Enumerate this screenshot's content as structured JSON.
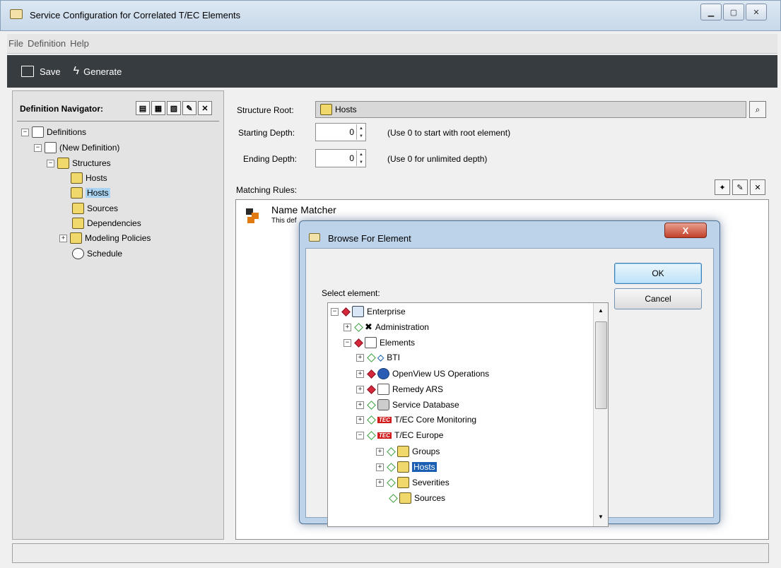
{
  "window": {
    "title": "Service Configuration for Correlated T/EC Elements"
  },
  "menu": [
    "File",
    "Definition",
    "Help"
  ],
  "toolbar": {
    "save": "Save",
    "generate": "Generate"
  },
  "navigator": {
    "title": "Definition Navigator:",
    "tree": [
      "Definitions",
      "(New Definition)",
      "Structures",
      "Hosts",
      "Hosts",
      "Sources",
      "Dependencies",
      "Modeling Policies",
      "Schedule"
    ]
  },
  "form": {
    "structure_root_label": "Structure Root:",
    "structure_root_value": "Hosts",
    "starting_depth_label": "Starting Depth:",
    "starting_depth_value": "0",
    "starting_depth_hint": "(Use 0 to start with root element)",
    "ending_depth_label": "Ending Depth:",
    "ending_depth_value": "0",
    "ending_depth_hint": "(Use 0 for unlimited depth)",
    "matching_rules_label": "Matching Rules:"
  },
  "rules": [
    {
      "name": "Name Matcher",
      "description": "This def"
    }
  ],
  "dialog": {
    "title": "Browse For Element",
    "select_label": "Select element:",
    "ok": "OK",
    "cancel": "Cancel",
    "close": "X",
    "tree": [
      "Enterprise",
      "Administration",
      "Elements",
      "BTI",
      "OpenView US Operations",
      "Remedy ARS",
      "Service Database",
      "T/EC Core Monitoring",
      "T/EC Europe",
      "Groups",
      "Hosts",
      "Severities",
      "Sources"
    ],
    "tec_badge": "TEC"
  }
}
